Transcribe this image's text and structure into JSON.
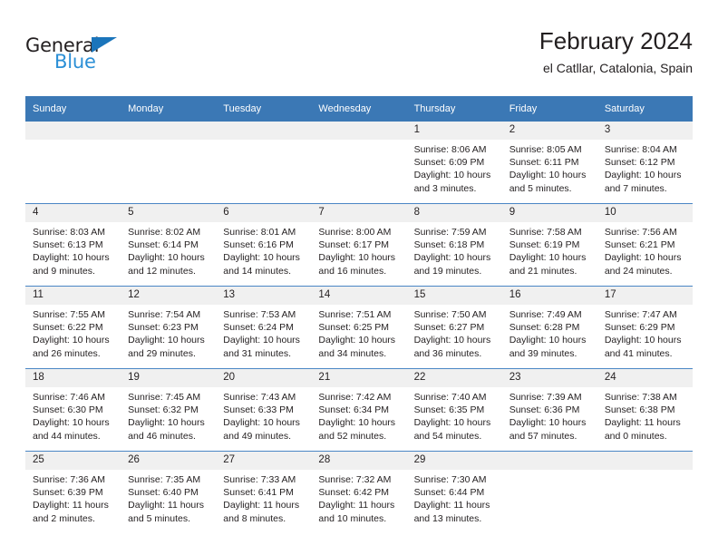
{
  "logo": {
    "word1": "General",
    "word2": "Blue",
    "triangle_color": "#1b75bb",
    "word2_color": "#2b8fd6"
  },
  "header": {
    "title": "February 2024",
    "subtitle": "el Catllar, Catalonia, Spain"
  },
  "theme": {
    "header_blue": "#3b78b5",
    "rule_blue": "#4a86c5",
    "daynum_band": "#f0f0f0",
    "text": "#231f20"
  },
  "weekdays": [
    "Sunday",
    "Monday",
    "Tuesday",
    "Wednesday",
    "Thursday",
    "Friday",
    "Saturday"
  ],
  "labels": {
    "sunrise_prefix": "Sunrise: ",
    "sunset_prefix": "Sunset: ",
    "daylight_prefix": "Daylight: "
  },
  "weeks": [
    [
      {
        "day": "",
        "empty": true
      },
      {
        "day": "",
        "empty": true
      },
      {
        "day": "",
        "empty": true
      },
      {
        "day": "",
        "empty": true
      },
      {
        "day": "1",
        "sunrise": "Sunrise: 8:06 AM",
        "sunset": "Sunset: 6:09 PM",
        "daylight": "Daylight: 10 hours and 3 minutes."
      },
      {
        "day": "2",
        "sunrise": "Sunrise: 8:05 AM",
        "sunset": "Sunset: 6:11 PM",
        "daylight": "Daylight: 10 hours and 5 minutes."
      },
      {
        "day": "3",
        "sunrise": "Sunrise: 8:04 AM",
        "sunset": "Sunset: 6:12 PM",
        "daylight": "Daylight: 10 hours and 7 minutes."
      }
    ],
    [
      {
        "day": "4",
        "sunrise": "Sunrise: 8:03 AM",
        "sunset": "Sunset: 6:13 PM",
        "daylight": "Daylight: 10 hours and 9 minutes."
      },
      {
        "day": "5",
        "sunrise": "Sunrise: 8:02 AM",
        "sunset": "Sunset: 6:14 PM",
        "daylight": "Daylight: 10 hours and 12 minutes."
      },
      {
        "day": "6",
        "sunrise": "Sunrise: 8:01 AM",
        "sunset": "Sunset: 6:16 PM",
        "daylight": "Daylight: 10 hours and 14 minutes."
      },
      {
        "day": "7",
        "sunrise": "Sunrise: 8:00 AM",
        "sunset": "Sunset: 6:17 PM",
        "daylight": "Daylight: 10 hours and 16 minutes."
      },
      {
        "day": "8",
        "sunrise": "Sunrise: 7:59 AM",
        "sunset": "Sunset: 6:18 PM",
        "daylight": "Daylight: 10 hours and 19 minutes."
      },
      {
        "day": "9",
        "sunrise": "Sunrise: 7:58 AM",
        "sunset": "Sunset: 6:19 PM",
        "daylight": "Daylight: 10 hours and 21 minutes."
      },
      {
        "day": "10",
        "sunrise": "Sunrise: 7:56 AM",
        "sunset": "Sunset: 6:21 PM",
        "daylight": "Daylight: 10 hours and 24 minutes."
      }
    ],
    [
      {
        "day": "11",
        "sunrise": "Sunrise: 7:55 AM",
        "sunset": "Sunset: 6:22 PM",
        "daylight": "Daylight: 10 hours and 26 minutes."
      },
      {
        "day": "12",
        "sunrise": "Sunrise: 7:54 AM",
        "sunset": "Sunset: 6:23 PM",
        "daylight": "Daylight: 10 hours and 29 minutes."
      },
      {
        "day": "13",
        "sunrise": "Sunrise: 7:53 AM",
        "sunset": "Sunset: 6:24 PM",
        "daylight": "Daylight: 10 hours and 31 minutes."
      },
      {
        "day": "14",
        "sunrise": "Sunrise: 7:51 AM",
        "sunset": "Sunset: 6:25 PM",
        "daylight": "Daylight: 10 hours and 34 minutes."
      },
      {
        "day": "15",
        "sunrise": "Sunrise: 7:50 AM",
        "sunset": "Sunset: 6:27 PM",
        "daylight": "Daylight: 10 hours and 36 minutes."
      },
      {
        "day": "16",
        "sunrise": "Sunrise: 7:49 AM",
        "sunset": "Sunset: 6:28 PM",
        "daylight": "Daylight: 10 hours and 39 minutes."
      },
      {
        "day": "17",
        "sunrise": "Sunrise: 7:47 AM",
        "sunset": "Sunset: 6:29 PM",
        "daylight": "Daylight: 10 hours and 41 minutes."
      }
    ],
    [
      {
        "day": "18",
        "sunrise": "Sunrise: 7:46 AM",
        "sunset": "Sunset: 6:30 PM",
        "daylight": "Daylight: 10 hours and 44 minutes."
      },
      {
        "day": "19",
        "sunrise": "Sunrise: 7:45 AM",
        "sunset": "Sunset: 6:32 PM",
        "daylight": "Daylight: 10 hours and 46 minutes."
      },
      {
        "day": "20",
        "sunrise": "Sunrise: 7:43 AM",
        "sunset": "Sunset: 6:33 PM",
        "daylight": "Daylight: 10 hours and 49 minutes."
      },
      {
        "day": "21",
        "sunrise": "Sunrise: 7:42 AM",
        "sunset": "Sunset: 6:34 PM",
        "daylight": "Daylight: 10 hours and 52 minutes."
      },
      {
        "day": "22",
        "sunrise": "Sunrise: 7:40 AM",
        "sunset": "Sunset: 6:35 PM",
        "daylight": "Daylight: 10 hours and 54 minutes."
      },
      {
        "day": "23",
        "sunrise": "Sunrise: 7:39 AM",
        "sunset": "Sunset: 6:36 PM",
        "daylight": "Daylight: 10 hours and 57 minutes."
      },
      {
        "day": "24",
        "sunrise": "Sunrise: 7:38 AM",
        "sunset": "Sunset: 6:38 PM",
        "daylight": "Daylight: 11 hours and 0 minutes."
      }
    ],
    [
      {
        "day": "25",
        "sunrise": "Sunrise: 7:36 AM",
        "sunset": "Sunset: 6:39 PM",
        "daylight": "Daylight: 11 hours and 2 minutes."
      },
      {
        "day": "26",
        "sunrise": "Sunrise: 7:35 AM",
        "sunset": "Sunset: 6:40 PM",
        "daylight": "Daylight: 11 hours and 5 minutes."
      },
      {
        "day": "27",
        "sunrise": "Sunrise: 7:33 AM",
        "sunset": "Sunset: 6:41 PM",
        "daylight": "Daylight: 11 hours and 8 minutes."
      },
      {
        "day": "28",
        "sunrise": "Sunrise: 7:32 AM",
        "sunset": "Sunset: 6:42 PM",
        "daylight": "Daylight: 11 hours and 10 minutes."
      },
      {
        "day": "29",
        "sunrise": "Sunrise: 7:30 AM",
        "sunset": "Sunset: 6:44 PM",
        "daylight": "Daylight: 11 hours and 13 minutes."
      },
      {
        "day": "",
        "empty": true
      },
      {
        "day": "",
        "empty": true
      }
    ]
  ]
}
